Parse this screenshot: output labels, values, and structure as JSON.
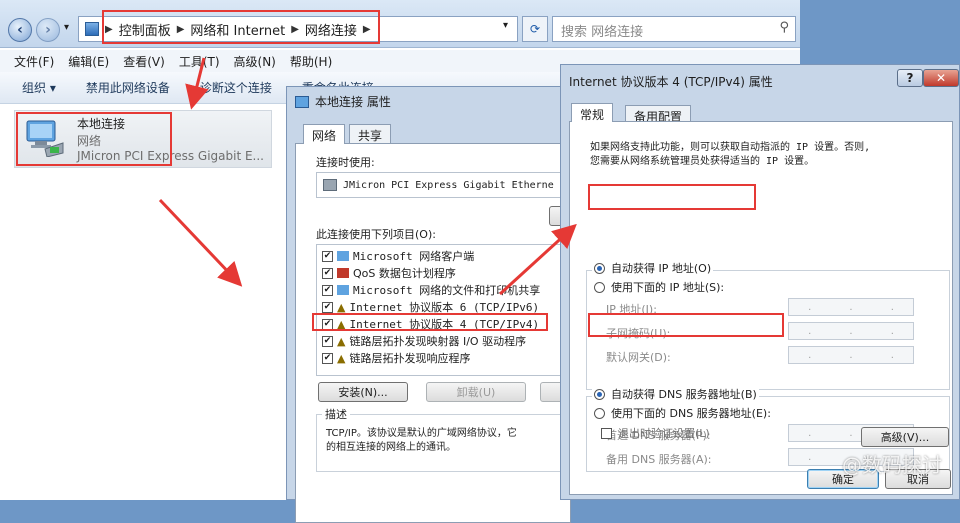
{
  "explorer": {
    "breadcrumb": [
      "控制面板",
      "网络和 Internet",
      "网络连接"
    ],
    "search_placeholder": "搜索 网络连接",
    "menu": [
      "文件(F)",
      "编辑(E)",
      "查看(V)",
      "工具(T)",
      "高级(N)",
      "帮助(H)"
    ],
    "commands": [
      "组织 ▾",
      "禁用此网络设备",
      "诊断这个连接",
      "重命名此连接"
    ],
    "connection": {
      "name": "本地连接",
      "type": "网络",
      "adapter": "JMicron PCI Express Gigabit E..."
    }
  },
  "props": {
    "title": "本地连接 属性",
    "tabs": [
      "网络",
      "共享"
    ],
    "connect_using_label": "连接时使用:",
    "adapter": "JMicron PCI Express Gigabit Etherne",
    "items_label": "此连接使用下列项目(O):",
    "items": [
      {
        "label": "Microsoft 网络客户端",
        "checked": true
      },
      {
        "label": "QoS 数据包计划程序",
        "checked": true
      },
      {
        "label": "Microsoft 网络的文件和打印机共享",
        "checked": true
      },
      {
        "label": "Internet 协议版本 6 (TCP/IPv6)",
        "checked": true
      },
      {
        "label": "Internet 协议版本 4 (TCP/IPv4)",
        "checked": true
      },
      {
        "label": "链路层拓扑发现映射器 I/O 驱动程序",
        "checked": true
      },
      {
        "label": "链路层拓扑发现响应程序",
        "checked": true
      }
    ],
    "install_label": "安装(N)...",
    "uninstall_label": "卸载(U)",
    "desc_label": "描述",
    "desc_text_1": "TCP/IP。该协议是默认的广域网络协议，它",
    "desc_text_2": "的相互连接的网络上的通讯。"
  },
  "ipv4": {
    "title": "Internet 协议版本 4 (TCP/IPv4) 属性",
    "help": "?",
    "close": "✕",
    "tabs": [
      "常规",
      "备用配置"
    ],
    "intro_1": "如果网络支持此功能，则可以获取自动指派的 IP 设置。否则,",
    "intro_2": "您需要从网络系统管理员处获得适当的 IP 设置。",
    "auto_ip": "自动获得 IP 地址(O)",
    "manual_ip": "使用下面的 IP 地址(S):",
    "ip_label": "IP 地址(I):",
    "mask_label": "子网掩码(U):",
    "gateway_label": "默认网关(D):",
    "auto_dns": "自动获得 DNS 服务器地址(B)",
    "manual_dns": "使用下面的 DNS 服务器地址(E):",
    "dns1_label": "首选 DNS 服务器(P):",
    "dns2_label": "备用 DNS 服务器(A):",
    "validate_label": "退出时验证设置(L)",
    "advanced_label": "高级(V)...",
    "ok_label": "确定",
    "cancel_label": "取消",
    "ip_sep": "."
  },
  "watermark": "@数码探讨",
  "colors": {
    "highlight": "#e53935",
    "dialog": "#c7d6e8"
  }
}
